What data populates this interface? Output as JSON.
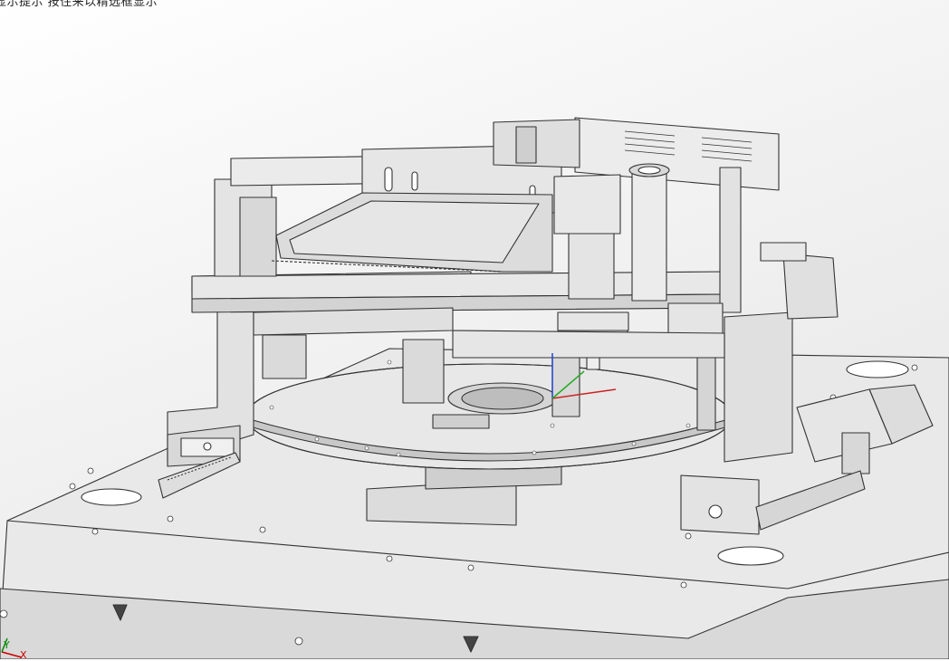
{
  "status_hint": "显示提示 按住来以精选框显示",
  "triad": {
    "x_label": "X",
    "y_label": "Y"
  },
  "colors": {
    "background_top": "#ffffff",
    "background_bottom": "#e4e4e4",
    "part_fill": "#e6e6e6",
    "part_dark": "#cfcfcf",
    "edge": "#333333"
  }
}
